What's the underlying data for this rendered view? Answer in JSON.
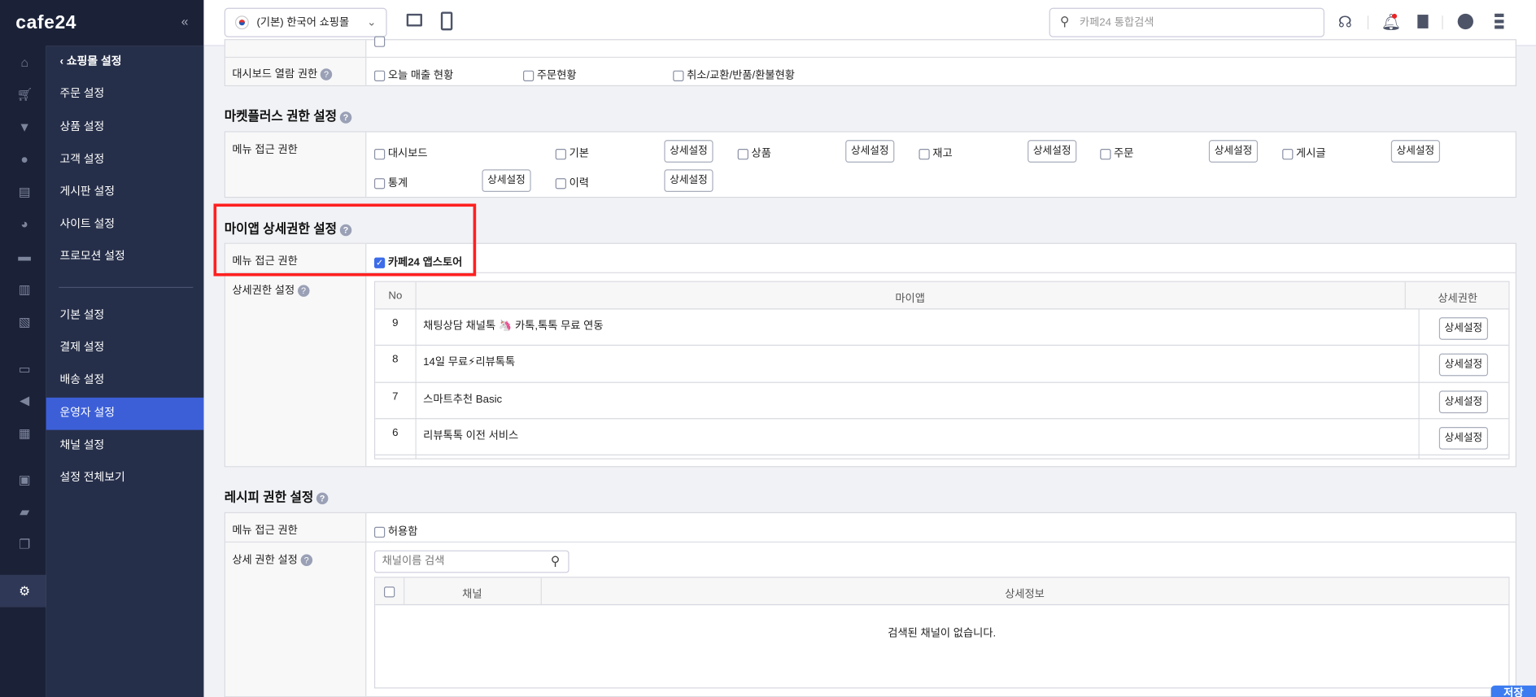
{
  "brand": "cafe24",
  "sidebar": {
    "back_label": "쇼핑몰 설정",
    "items": [
      {
        "label": "주문 설정"
      },
      {
        "label": "상품 설정"
      },
      {
        "label": "고객 설정"
      },
      {
        "label": "게시판 설정"
      },
      {
        "label": "사이트 설정"
      },
      {
        "label": "프로모션 설정"
      },
      {
        "label": "기본 설정"
      },
      {
        "label": "결제 설정"
      },
      {
        "label": "배송 설정"
      },
      {
        "label": "운영자 설정",
        "active": true
      },
      {
        "label": "채널 설정"
      },
      {
        "label": "설정 전체보기"
      }
    ]
  },
  "header": {
    "mall_select": "(기본) 한국어 쇼핑몰",
    "search_placeholder": "카페24 통합검색"
  },
  "dashboard": {
    "label": "대시보드 열람 권한",
    "options": [
      "오늘 매출 현황",
      "주문현황",
      "취소/교환/반품/환불현황"
    ]
  },
  "marketplus": {
    "title": "마켓플러스 권한 설정",
    "row_label": "메뉴 접근 권한",
    "items": [
      "대시보드",
      "기본",
      "상품",
      "재고",
      "주문",
      "게시글",
      "통계",
      "이력"
    ],
    "detail_label": "상세설정"
  },
  "myapp": {
    "title": "마이앱 상세권한 설정",
    "access_label": "메뉴 접근 권한",
    "access_option": "카페24 앱스토어",
    "access_checked": true,
    "detail_label": "상세권한 설정",
    "columns": [
      "No",
      "마이앱",
      "상세권한"
    ],
    "rows": [
      {
        "no": "9",
        "name": "채팅상담 채널톡 🦄 카톡,톡톡 무료 연동"
      },
      {
        "no": "8",
        "name": "14일 무료⚡리뷰톡톡"
      },
      {
        "no": "7",
        "name": "스마트추천 Basic"
      },
      {
        "no": "6",
        "name": "리뷰톡톡 이전 서비스"
      }
    ],
    "button": "상세설정"
  },
  "recipe": {
    "title": "레시피 권한 설정",
    "access_label": "메뉴 접근 권한",
    "access_option": "허용함",
    "detail_label": "상세 권한 설정",
    "search_placeholder": "채널이름 검색",
    "columns": [
      "채널",
      "상세정보"
    ],
    "empty": "검색된 채널이 없습니다."
  },
  "save_label": "저장",
  "colors": {
    "accent": "#3c5fd8",
    "highlight": "#ff2020"
  }
}
